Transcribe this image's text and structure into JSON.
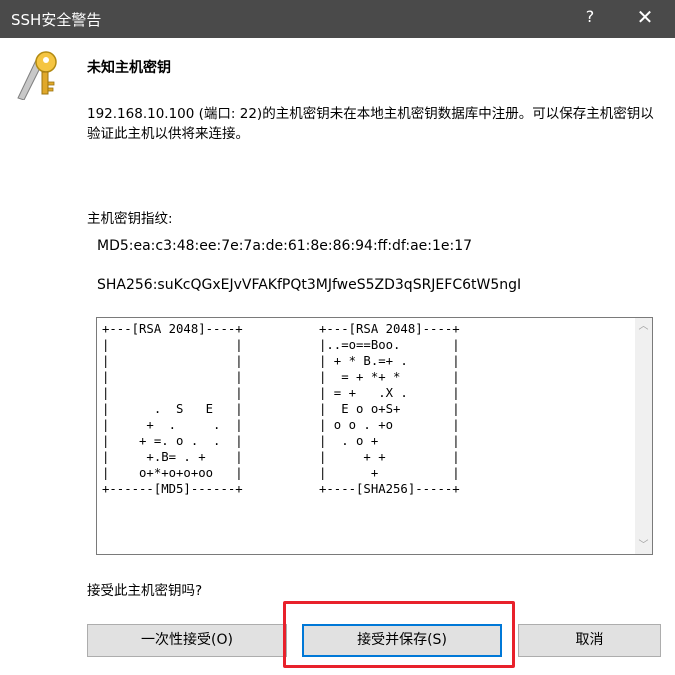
{
  "window": {
    "title": "SSH安全警告",
    "help_label": "?",
    "close_label": "✕"
  },
  "dialog": {
    "heading": "未知主机密钥",
    "message": "192.168.10.100 (端口: 22)的主机密钥未在本地主机密钥数据库中注册。可以保存主机密钥以验证此主机以供将来连接。",
    "fingerprint_label": "主机密钥指纹:",
    "md5": "MD5:ea:c3:48:ee:7e:7a:de:61:8e:86:94:ff:df:ae:1e:17",
    "sha256": "SHA256:suKcQGxEJvVFAKfPQt3MJfweS5ZD3qSRJEFC6tW5ngI",
    "randomart_md5": "+---[RSA 2048]----+\n|                 |\n|                 |\n|                 |\n|                 |\n|      .  S   E   |\n|     +  .     .  |\n|    + =. o .  .  |\n|     +.B= . +    |\n|    o+*+o+o+oo   |\n+------[MD5]------+",
    "randomart_sha256": "+---[RSA 2048]----+\n|..=o==Boo.       |\n| + * B.=+ .      |\n|  = + *+ *       |\n| = +   .X .      |\n|  E o o+S+       |\n| o o . +o        |\n|  . o +          |\n|     + +         |\n|      +          |\n+----[SHA256]-----+",
    "question": "接受此主机密钥吗?"
  },
  "buttons": {
    "accept_once": "一次性接受(O)",
    "accept_save": "接受并保存(S)",
    "cancel": "取消"
  },
  "icons": {
    "window_icon": "key-icon",
    "scroll_up": "chevron-up-icon",
    "scroll_down": "chevron-down-icon"
  },
  "colors": {
    "titlebar": "#4a4a4a",
    "highlight": "#e8212b",
    "focus_border": "#0078d7"
  }
}
